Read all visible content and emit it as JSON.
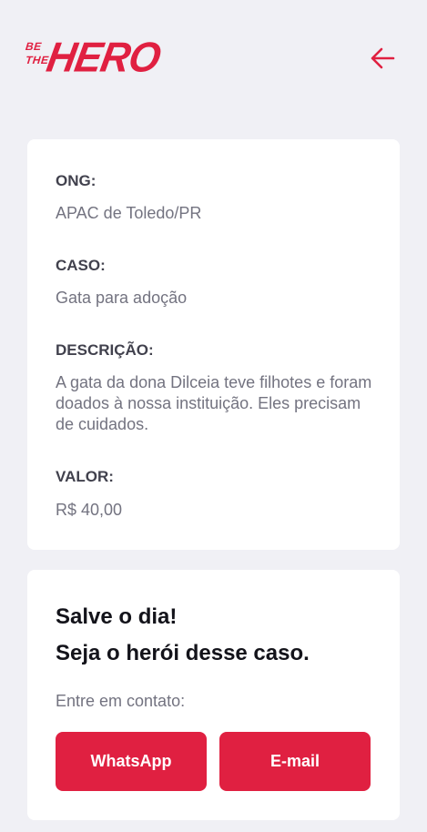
{
  "header": {
    "logo": {
      "small_top": "BE",
      "small_bottom": "THE",
      "main": "HERO"
    },
    "back_icon": "arrow-left-icon",
    "accent_color": "#e02041"
  },
  "incident": {
    "ong_label": "ONG:",
    "ong_value": "APAC de Toledo/PR",
    "case_label": "CASO:",
    "case_value": "Gata para adoção",
    "description_label": "DESCRIÇÃO:",
    "description_value": "A gata da dona Dilceia teve filhotes e foram doados à nossa instituição. Eles precisam de cuidados.",
    "value_label": "VALOR:",
    "value_value": "R$ 40,00"
  },
  "contact": {
    "title_line1": "Salve o dia!",
    "title_line2": "Seja o herói desse caso.",
    "subtitle": "Entre em contato:",
    "whatsapp_label": "WhatsApp",
    "email_label": "E-mail"
  }
}
